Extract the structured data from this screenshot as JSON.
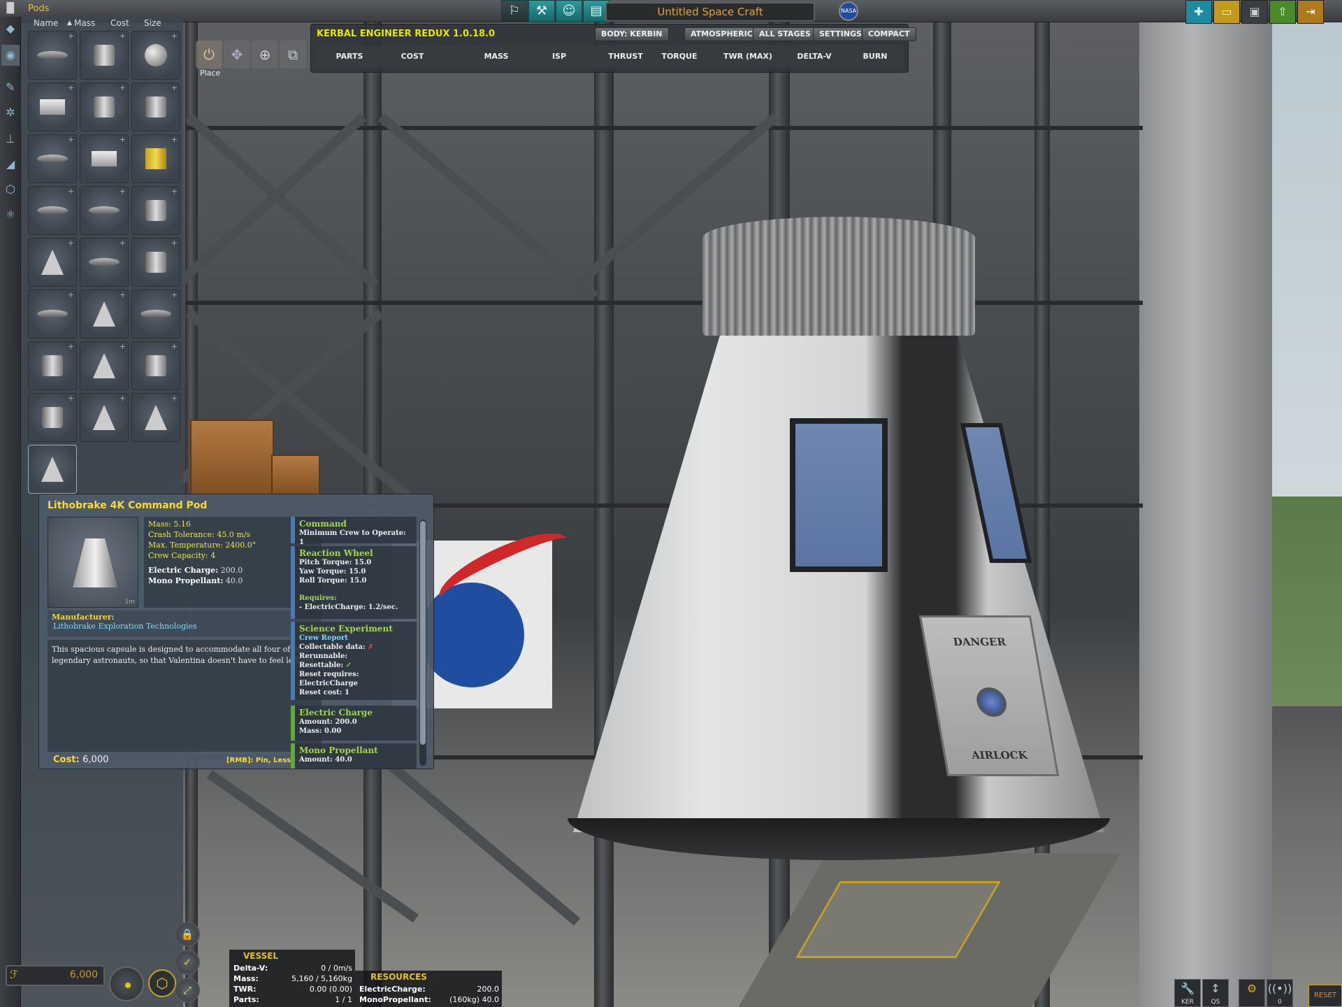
{
  "topbar": {
    "category_title": "Pods",
    "craft_name": "Untitled Space Craft",
    "agency_logo": "NASA"
  },
  "sort": {
    "name": "Name",
    "mass": "Mass",
    "cost": "Cost",
    "size": "Size"
  },
  "gizmo": {
    "place_label": "Place"
  },
  "ker": {
    "title": "KERBAL ENGINEER REDUX 1.0.18.0",
    "buttons": [
      "BODY: KERBIN",
      "ATMOSPHERIC",
      "ALL STAGES",
      "SETTINGS",
      "COMPACT"
    ],
    "columns": [
      "PARTS",
      "COST",
      "MASS",
      "ISP",
      "THRUST",
      "TORQUE",
      "TWR (MAX)",
      "DELTA-V",
      "BURN"
    ]
  },
  "part_info": {
    "title": "Lithobrake 4K Command Pod",
    "scale": "1m",
    "stats": [
      {
        "k": "Mass:",
        "v": "5.16"
      },
      {
        "k": "Crash Tolerance:",
        "v": "45.0 m/s"
      },
      {
        "k": "Max. Temperature:",
        "v": "2400.0°"
      },
      {
        "k": "Crew Capacity:",
        "v": "4"
      }
    ],
    "resources": [
      {
        "k": "Electric Charge:",
        "v": "200.0"
      },
      {
        "k": "Mono Propellant:",
        "v": "40.0"
      }
    ],
    "manufacturer_label": "Manufacturer:",
    "manufacturer": "Lithobrake Exploration Technologies",
    "description": "This spacious capsule is designed to accommodate all four of your legendary astronauts, so that Valentina doesn't have to feel left out.",
    "cost_label": "Cost:",
    "cost": "6,000",
    "rmb_hint": "[RMB]: Pin, Less",
    "modules": {
      "command": {
        "title": "Command",
        "line": "Minimum Crew to Operate: 1"
      },
      "wheel": {
        "title": "Reaction Wheel",
        "pitch": "Pitch Torque: 15.0",
        "yaw": "Yaw Torque: 15.0",
        "roll": "Roll Torque: 15.0",
        "req": "Requires:",
        "req_line": "- ElectricCharge: 1.2/sec."
      },
      "science": {
        "title": "Science Experiment",
        "sub": "Crew Report",
        "collect": "Collectable data:",
        "collect_mark": "✗",
        "rerun": "Rerunnable:",
        "reset": "Resettable:",
        "reset_mark": "✓",
        "reset_req": "Reset requires: ElectricCharge",
        "reset_cost": "Reset cost: 1"
      },
      "ec": {
        "title": "Electric Charge",
        "amount": "Amount: 200.0",
        "mass": "Mass: 0.00"
      },
      "mono": {
        "title": "Mono Propellant",
        "amount": "Amount: 40.0"
      }
    }
  },
  "bottom": {
    "funds": "6,000",
    "vessel": {
      "header": "VESSEL",
      "rows": [
        {
          "k": "Delta-V:",
          "v": "0 / 0m/s"
        },
        {
          "k": "Mass:",
          "v": "5,160 / 5,160kg"
        },
        {
          "k": "TWR:",
          "v": "0.00 (0.00)"
        },
        {
          "k": "Parts:",
          "v": "1 / 1"
        }
      ]
    },
    "resources": {
      "header": "RESOURCES",
      "rows": [
        {
          "k": "ElectricCharge:",
          "v": "200.0"
        },
        {
          "k": "MonoPropellant:",
          "v": "(160kg) 40.0"
        }
      ]
    },
    "right_labels": {
      "ker": "KER",
      "qs": "QS",
      "zero": "0",
      "reset": "RESET"
    }
  },
  "colors": {
    "accent_yellow": "#e8c31d",
    "ker_title": "#e6e600",
    "teal_button": "#2f9a9e"
  }
}
